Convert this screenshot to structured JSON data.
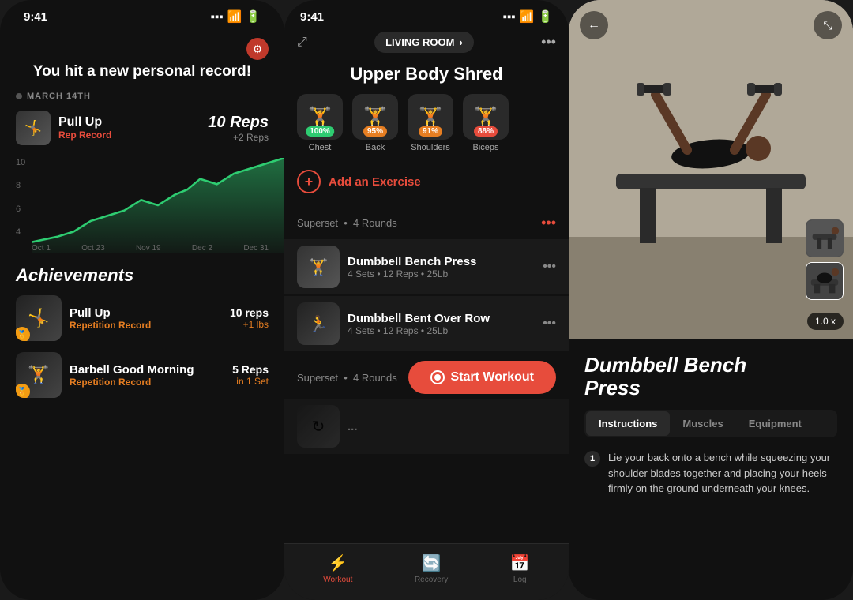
{
  "panel1": {
    "statusbar": {
      "time": "9:41"
    },
    "headline": "You hit a new personal record!",
    "date": "MARCH 14TH",
    "record": {
      "name": "Pull Up",
      "sub": "Rep Record",
      "reps": "10",
      "unit": " Reps",
      "delta": "+2 Reps"
    },
    "chart": {
      "yLabels": [
        "10",
        "8",
        "6",
        "4"
      ],
      "xLabels": [
        "Oct 1",
        "Oct 23",
        "Nov 19",
        "Dec 2",
        "Dec 31"
      ]
    },
    "achievements_title": "Achievements",
    "achievements": [
      {
        "name": "Pull Up",
        "sub": "Repetition Record",
        "reps": "10 reps",
        "detail": "+1 lbs"
      },
      {
        "name": "Barbell Good Morning",
        "sub": "Repetition Record",
        "reps": "5 Reps",
        "detail": "in 1 Set"
      }
    ]
  },
  "panel2": {
    "statusbar": {
      "time": "9:41"
    },
    "location": "LIVING ROOM",
    "title": "Upper Body Shred",
    "muscles": [
      {
        "label": "Chest",
        "pct": "100%",
        "pctClass": "pct-green",
        "emoji": "🏋"
      },
      {
        "label": "Back",
        "pct": "95%",
        "pctClass": "pct-orange",
        "emoji": "🏋"
      },
      {
        "label": "Shoulders",
        "pct": "91%",
        "pctClass": "pct-orange",
        "emoji": "🏋"
      },
      {
        "label": "Biceps",
        "pct": "88%",
        "pctClass": "pct-red",
        "emoji": "🏋"
      }
    ],
    "add_exercise": "Add an Exercise",
    "superset1": {
      "label": "Superset",
      "rounds": "4 Rounds"
    },
    "exercises": [
      {
        "name": "Dumbbell Bench Press",
        "detail": "4 Sets • 12 Reps • 25Lb"
      },
      {
        "name": "Dumbbell Bent Over Row",
        "detail": "4 Sets • 12 Reps • 25Lb"
      }
    ],
    "superset2": {
      "label": "Superset",
      "rounds": "4 Rounds"
    },
    "start_workout": "Start Workout",
    "nav": {
      "workout": "Workout",
      "recovery": "Recovery",
      "log": "Log"
    }
  },
  "panel3": {
    "back_label": "←",
    "exercise_title": "Dumbbell Bench\nPress",
    "speed": "1.0 x",
    "tabs": [
      "Instructions",
      "Muscles",
      "Equipment"
    ],
    "active_tab": "Instructions",
    "instruction": "Lie your back onto a bench while squeezing your shoulder blades together and placing your heels firmly on the ground underneath your knees."
  }
}
